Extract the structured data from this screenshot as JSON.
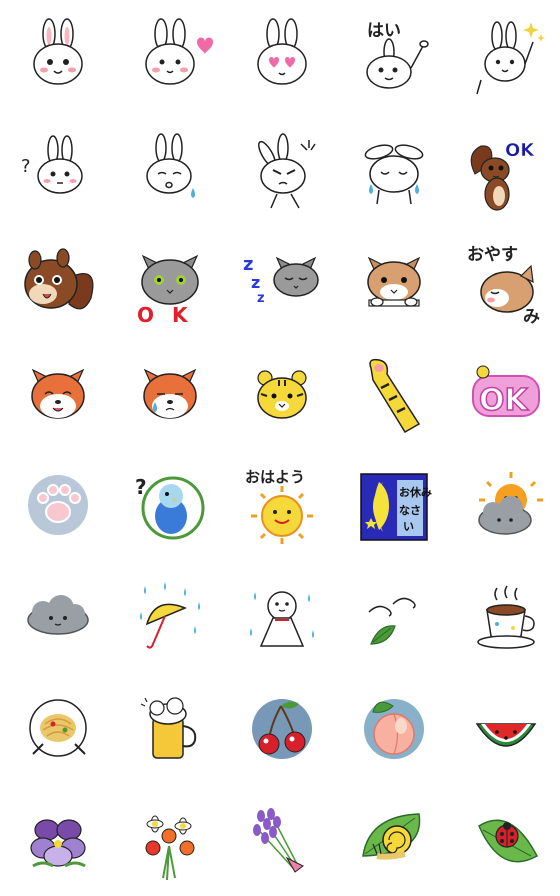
{
  "sheet": {
    "columns": 5,
    "rows": 8,
    "stickers": [
      {
        "name": "rabbit-smile-icon",
        "text": ""
      },
      {
        "name": "rabbit-heart-icon",
        "text": ""
      },
      {
        "name": "rabbit-heart-eyes-icon",
        "text": ""
      },
      {
        "name": "rabbit-hai-icon",
        "text": "はい"
      },
      {
        "name": "rabbit-sparkle-wave-icon",
        "text": ""
      },
      {
        "name": "rabbit-question-icon",
        "text": "?"
      },
      {
        "name": "rabbit-sad-icon",
        "text": ""
      },
      {
        "name": "rabbit-angry-icon",
        "text": ""
      },
      {
        "name": "rabbit-crying-icon",
        "text": ""
      },
      {
        "name": "squirrel-ok-icon",
        "text": "OK"
      },
      {
        "name": "squirrel-face-icon",
        "text": ""
      },
      {
        "name": "gray-cat-ok-icon",
        "text": "OK"
      },
      {
        "name": "gray-cat-sleeping-icon",
        "text": "zzz"
      },
      {
        "name": "tabby-cat-peek-icon",
        "text": ""
      },
      {
        "name": "cat-oyasumi-icon",
        "text": "おやすみ"
      },
      {
        "name": "shiba-happy-icon",
        "text": ""
      },
      {
        "name": "shiba-crying-icon",
        "text": ""
      },
      {
        "name": "tiger-face-icon",
        "text": ""
      },
      {
        "name": "tiger-paw-wave-icon",
        "text": ""
      },
      {
        "name": "ok-badge-icon",
        "text": "OK"
      },
      {
        "name": "paw-print-icon",
        "text": ""
      },
      {
        "name": "parakeet-question-icon",
        "text": "?"
      },
      {
        "name": "sun-ohayou-icon",
        "text": "おはよう"
      },
      {
        "name": "moon-oyasuminasai-icon",
        "text": "お休みなさい"
      },
      {
        "name": "sun-cloud-icon",
        "text": ""
      },
      {
        "name": "cloud-icon",
        "text": ""
      },
      {
        "name": "umbrella-rain-icon",
        "text": ""
      },
      {
        "name": "teru-teru-bozu-icon",
        "text": ""
      },
      {
        "name": "leaf-wind-icon",
        "text": ""
      },
      {
        "name": "coffee-cup-icon",
        "text": ""
      },
      {
        "name": "pasta-plate-icon",
        "text": ""
      },
      {
        "name": "beer-mug-icon",
        "text": ""
      },
      {
        "name": "cherries-icon",
        "text": ""
      },
      {
        "name": "peach-icon",
        "text": ""
      },
      {
        "name": "watermelon-icon",
        "text": ""
      },
      {
        "name": "pansy-icon",
        "text": ""
      },
      {
        "name": "flower-bouquet-icon",
        "text": ""
      },
      {
        "name": "lavender-bouquet-icon",
        "text": ""
      },
      {
        "name": "snail-leaf-icon",
        "text": ""
      },
      {
        "name": "ladybug-leaf-icon",
        "text": ""
      }
    ]
  },
  "colors": {
    "line": "#222222",
    "blush": "#f4a0a8",
    "pink": "#f06aa8",
    "squirrel": "#7a3a1e",
    "cat_gray": "#8c8c8c",
    "orange": "#e8703a",
    "yellow": "#f5d93a",
    "moon_bg": "#2a2ab8",
    "cloud": "#9a9fa6",
    "green": "#4a9a3a",
    "red": "#d8202a"
  }
}
